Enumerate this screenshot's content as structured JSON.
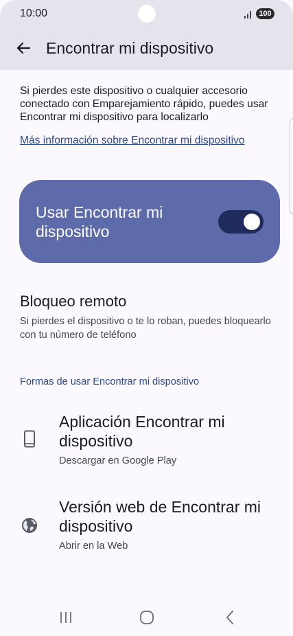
{
  "status_bar": {
    "time": "10:00",
    "battery": "100"
  },
  "header": {
    "title": "Encontrar mi dispositivo"
  },
  "description": "Si pierdes este dispositivo o cualquier accesorio conectado con Emparejamiento rápido, puedes usar Encontrar mi dispositivo para localizarlo",
  "more_info_link": "Más información sobre Encontrar mi dispositivo",
  "main_toggle": {
    "label": "Usar Encontrar mi dispositivo",
    "enabled": true
  },
  "remote_lock": {
    "title": "Bloqueo remoto",
    "subtitle": "Si pierdes el dispositivo o te lo roban, puedes bloquearlo con tu número de teléfono"
  },
  "section_header": "Formas de usar Encontrar mi dispositivo",
  "options": [
    {
      "title": "Aplicación Encontrar mi dispositivo",
      "subtitle": "Descargar en Google Play",
      "icon": "phone-icon"
    },
    {
      "title": "Versión web de Encontrar mi dispositivo",
      "subtitle": "Abrir en la Web",
      "icon": "globe-icon"
    }
  ],
  "nav_bar": {
    "recents_icon": "recents-icon",
    "home_icon": "home-icon",
    "back_icon": "back-icon"
  },
  "colors": {
    "header_bg": "#E5E4EC",
    "page_bg": "#FBF8FE",
    "card_bg": "#5D6BAA",
    "switch_track": "#1F2B5C",
    "accent_text": "#2C4A8A"
  }
}
